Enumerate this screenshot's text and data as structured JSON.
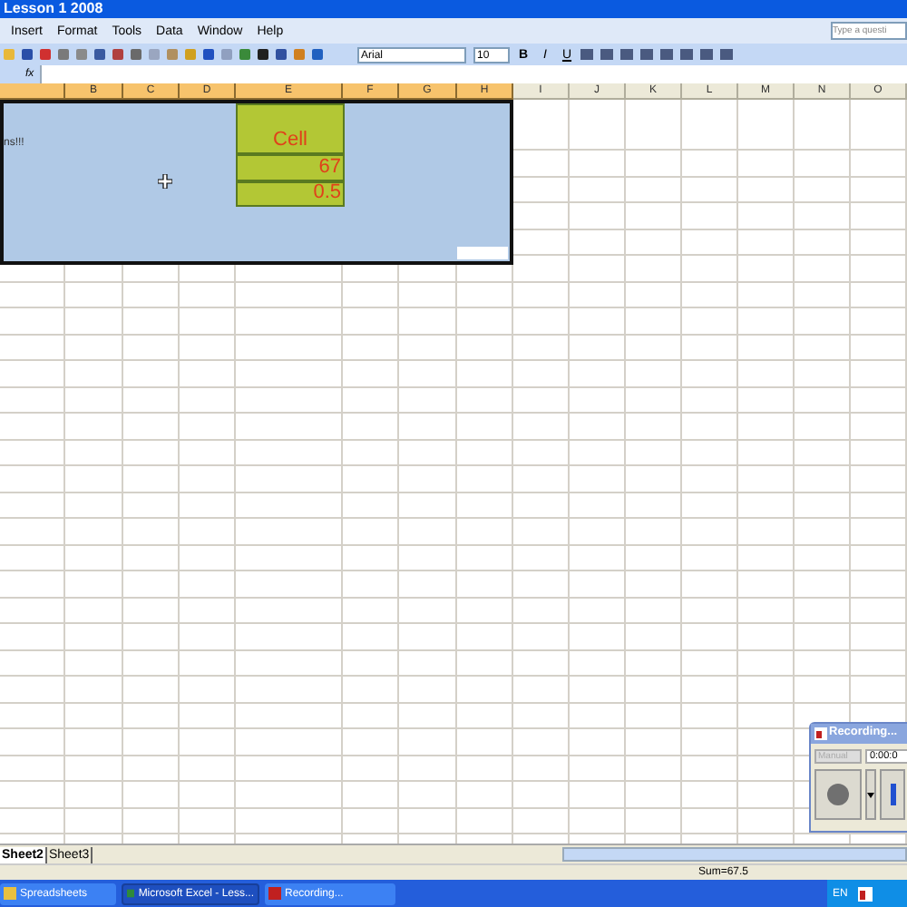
{
  "window": {
    "title": "Lesson 1 2008"
  },
  "menu": [
    "Insert",
    "Format",
    "Tools",
    "Data",
    "Window",
    "Help"
  ],
  "help_search": {
    "placeholder": "Type a questi"
  },
  "font": {
    "name": "Arial",
    "size": "10"
  },
  "format_buttons": [
    "B",
    "I",
    "U"
  ],
  "formula_bar": {
    "label": "fx"
  },
  "columns": [
    {
      "selected": true
    },
    {
      "label": "B",
      "selected": true
    },
    {
      "label": "C",
      "selected": true
    },
    {
      "label": "D",
      "selected": true
    },
    {
      "label": "E",
      "selected": true
    },
    {
      "label": "F",
      "selected": true
    },
    {
      "label": "G",
      "selected": true
    },
    {
      "label": "H",
      "selected": true
    },
    {
      "label": "I",
      "selected": false
    },
    {
      "label": "J",
      "selected": false
    },
    {
      "label": "K",
      "selected": false
    },
    {
      "label": "L",
      "selected": false
    },
    {
      "label": "M",
      "selected": false
    },
    {
      "label": "N",
      "selected": false
    },
    {
      "label": "O",
      "selected": false
    }
  ],
  "note_text": "ns!!!",
  "cells": [
    {
      "text": "Cell",
      "kind": "label"
    },
    {
      "text": "67",
      "kind": "number"
    },
    {
      "text": "0.5",
      "kind": "number"
    }
  ],
  "sheet_tabs": [
    {
      "label": "Sheet2",
      "selected": true
    },
    {
      "label": "Sheet3",
      "selected": false
    }
  ],
  "status_bar": {
    "sum": "Sum=67.5"
  },
  "recorder": {
    "title": "Recording...",
    "mode": "Manual",
    "mode_disabled": true,
    "time": "0:00:0"
  },
  "taskbar": [
    {
      "label": "Spreadsheets",
      "selected": false
    },
    {
      "label": "Microsoft Excel - Less...",
      "selected": true
    },
    {
      "label": "Recording...",
      "selected": false
    }
  ],
  "tray": {
    "language": "EN"
  }
}
